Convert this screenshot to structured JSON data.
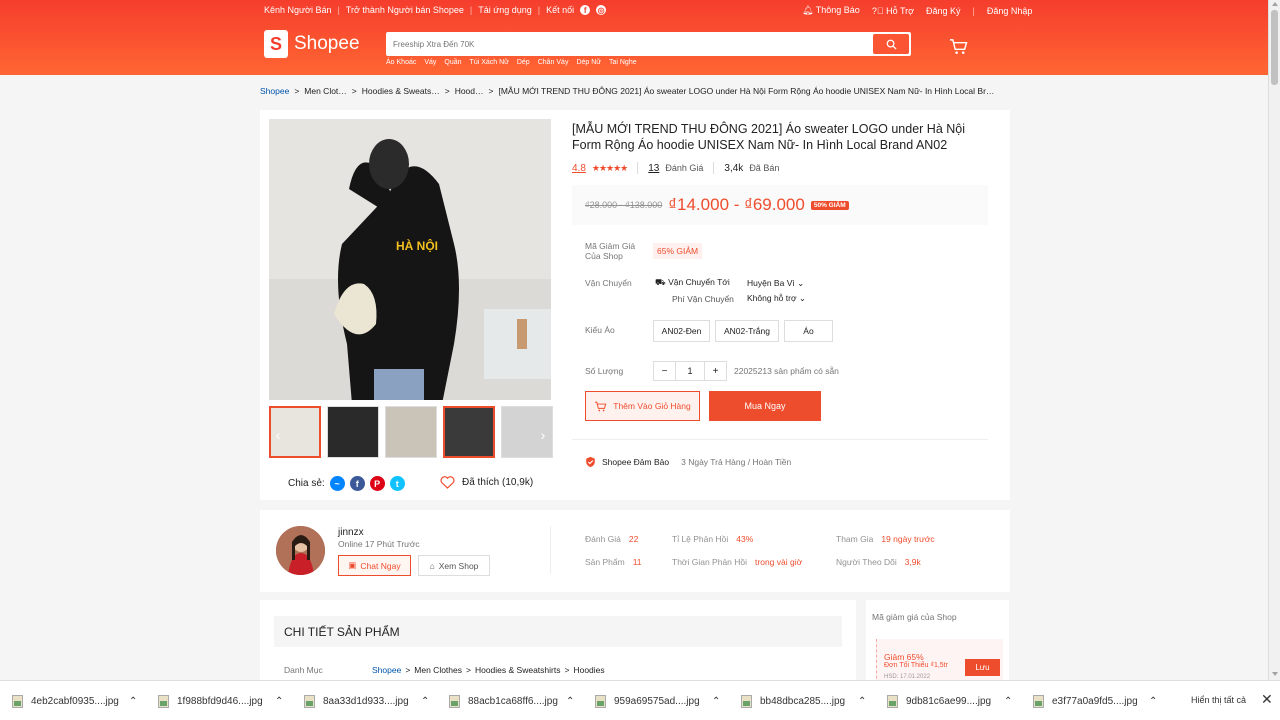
{
  "header": {
    "top_left": [
      "Kênh Người Bán",
      "Trở thành Người bán Shopee",
      "Tải ứng dụng",
      "Kết nối"
    ],
    "top_right": {
      "notifications": "Thông Báo",
      "help": "Hỗ Trợ",
      "register": "Đăng Ký",
      "login": "Đăng Nhập"
    },
    "logo": "Shopee",
    "search_placeholder": "Freeship Xtra Đến 70K",
    "keywords": [
      "Áo Khoác",
      "Váy",
      "Quần",
      "Túi Xách Nữ",
      "Dép",
      "Chân Váy",
      "Dép Nữ",
      "Tai Nghe"
    ]
  },
  "breadcrumb": [
    "Shopee",
    "Men Clot…",
    "Hoodies & Sweats…",
    "Hood…",
    "[MẪU MỚI TREND THU ĐÔNG 2021] Áo sweater LOGO under Hà Nội Form Rộng Áo hoodie UNISEX Nam Nữ- In Hình Local Br…"
  ],
  "product": {
    "title": "[MẪU MỚI TREND THU ĐÔNG 2021] Áo sweater LOGO under Hà Nội Form Rộng Áo hoodie UNISEX Nam Nữ- In Hình Local Brand AN02",
    "rating": "4.8",
    "stars": "★★★★★",
    "reviews_count": "13",
    "reviews_label": "Đánh Giá",
    "sold_count": "3,4k",
    "sold_label": "Đã Bán",
    "old_price": "₫28.000 - ₫138.000",
    "price": "₫14.000 - ₫69.000",
    "discount": "50% GIẢM",
    "shirt_text": "HÀ NỘI",
    "voucher_label": "Mã Giảm Giá Của Shop",
    "voucher": "65% GIẢM",
    "shipping_label": "Vận Chuyển",
    "ship_to_label": "Vận Chuyển Tới",
    "ship_to": "Huyện Ba Vì",
    "ship_fee_label": "Phí Vận Chuyển",
    "ship_fee": "Không hỗ trợ",
    "variant_label": "Kiểu Áo",
    "variants": [
      "AN02-Đen",
      "AN02-Trắng",
      "Áo"
    ],
    "qty_label": "Số Lượng",
    "qty": "1",
    "qty_minus": "−",
    "qty_plus": "+",
    "available": "22025213 sản phẩm có sẵn",
    "add_to_cart": "Thêm Vào Giỏ Hàng",
    "buy_now": "Mua Ngay",
    "guarantee": "Shopee Đảm Bảo",
    "guarantee_note": "3 Ngày Trả Hàng / Hoàn Tiền",
    "share_label": "Chia sẻ:",
    "liked": "Đã thích (10,9k)"
  },
  "shop": {
    "name": "jinnzx",
    "online": "Online 17 Phút Trước",
    "chat": "Chat Ngay",
    "view": "Xem Shop",
    "stats": [
      {
        "label": "Đánh Giá",
        "value": "22"
      },
      {
        "label": "Tỉ Lệ Phản Hồi",
        "value": "43%"
      },
      {
        "label": "Tham Gia",
        "value": "19 ngày trước"
      },
      {
        "label": "Sản Phẩm",
        "value": "11"
      },
      {
        "label": "Thời Gian Phản Hồi",
        "value": "trong vài giờ"
      },
      {
        "label": "Người Theo Dõi",
        "value": "3,9k"
      }
    ]
  },
  "details": {
    "heading": "CHI TIẾT SẢN PHẨM",
    "category_label": "Danh Mục",
    "category_path": [
      "Shopee",
      "Men Clothes",
      "Hoodies & Sweatshirts",
      "Hoodies"
    ]
  },
  "shop_vouchers": {
    "title": "Mã giảm giá của Shop",
    "voucher_title": "Giảm 65%",
    "voucher_min": "Đơn Tối Thiểu ₫1,5tr",
    "voucher_exp": "HSD: 17.01.2022",
    "save": "Lưu"
  },
  "downloads": {
    "files": [
      "4eb2cabf0935....jpg",
      "1f988bfd9d46....jpg",
      "8aa33d1d933....jpg",
      "88acb1ca68ff6....jpg",
      "959a69575ad....jpg",
      "bb48dbca285....jpg",
      "9db81c6ae99....jpg",
      "e3f77a0a9fd5....jpg"
    ],
    "show_all": "Hiển thị tất cả"
  },
  "colors": {
    "brand": "#ee4d2d",
    "header_start": "#f53d2d",
    "header_end": "#ff6633"
  }
}
